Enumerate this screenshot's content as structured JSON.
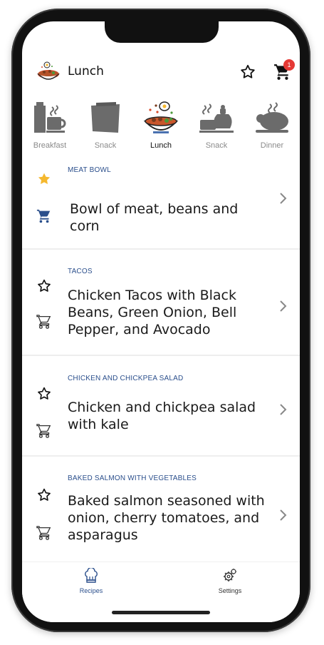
{
  "header": {
    "title": "Lunch",
    "logo_icon": "food-bowl-icon",
    "cart_count": "1"
  },
  "meals": [
    {
      "label": "Breakfast",
      "icon": "breakfast-icon",
      "active": false
    },
    {
      "label": "Snack",
      "icon": "snack-icon",
      "active": false
    },
    {
      "label": "Lunch",
      "icon": "lunch-bowl-icon",
      "active": true
    },
    {
      "label": "Snack",
      "icon": "tea-snack-icon",
      "active": false
    },
    {
      "label": "Dinner",
      "icon": "dinner-icon",
      "active": false
    }
  ],
  "recipes": [
    {
      "category": "MEAT BOWL",
      "title": "Bowl of meat, beans and corn",
      "favorite": true,
      "in_cart": true
    },
    {
      "category": "TACOS",
      "title": "Chicken Tacos with Black Beans, Green Onion, Bell Pepper, and Avocado",
      "favorite": false,
      "in_cart": false
    },
    {
      "category": "CHICKEN AND CHICKPEA SALAD",
      "title": "Chicken and chickpea salad with kale",
      "favorite": false,
      "in_cart": false
    },
    {
      "category": "BAKED SALMON WITH VEGETABLES",
      "title": "Baked salmon seasoned with onion, cherry tomatoes, and asparagus",
      "favorite": false,
      "in_cart": false
    }
  ],
  "bottom_nav": {
    "recipes_label": "Recipes",
    "settings_label": "Settings"
  },
  "colors": {
    "accent": "#2b4f8c",
    "favorite": "#f5b82e",
    "badge": "#e53935"
  }
}
